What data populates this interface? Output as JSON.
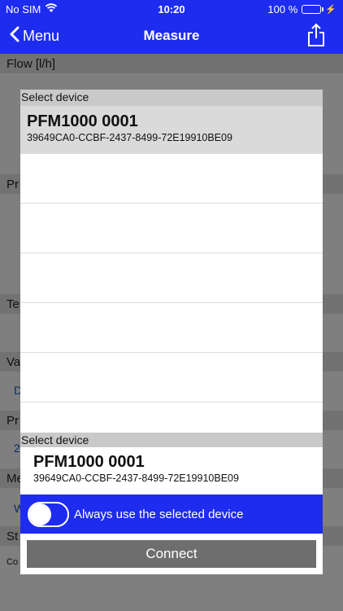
{
  "status_bar": {
    "carrier": "No SIM",
    "time": "10:20",
    "battery_text": "100 %"
  },
  "nav": {
    "back_label": "Menu",
    "title": "Measure"
  },
  "background": {
    "sections": [
      "Flow [l/h]",
      "Pr",
      "Te",
      "Va",
      "Pr",
      "Me",
      "St"
    ],
    "links": [
      "D",
      "2",
      "W"
    ],
    "misc": [
      "Co"
    ]
  },
  "dialog": {
    "list_header": "Select device",
    "devices": [
      {
        "name": "PFM1000 0001",
        "id": "39649CA0-CCBF-2437-8499-72E19910BE09"
      }
    ],
    "selected_header": "Select device",
    "selected": {
      "name": "PFM1000 0001",
      "id": "39649CA0-CCBF-2437-8499-72E19910BE09"
    },
    "toggle_label": "Always use the selected device",
    "toggle_on": false,
    "connect_label": "Connect"
  },
  "colors": {
    "brand_blue": "#1e2cf0",
    "button_gray": "#6e6e6e"
  }
}
